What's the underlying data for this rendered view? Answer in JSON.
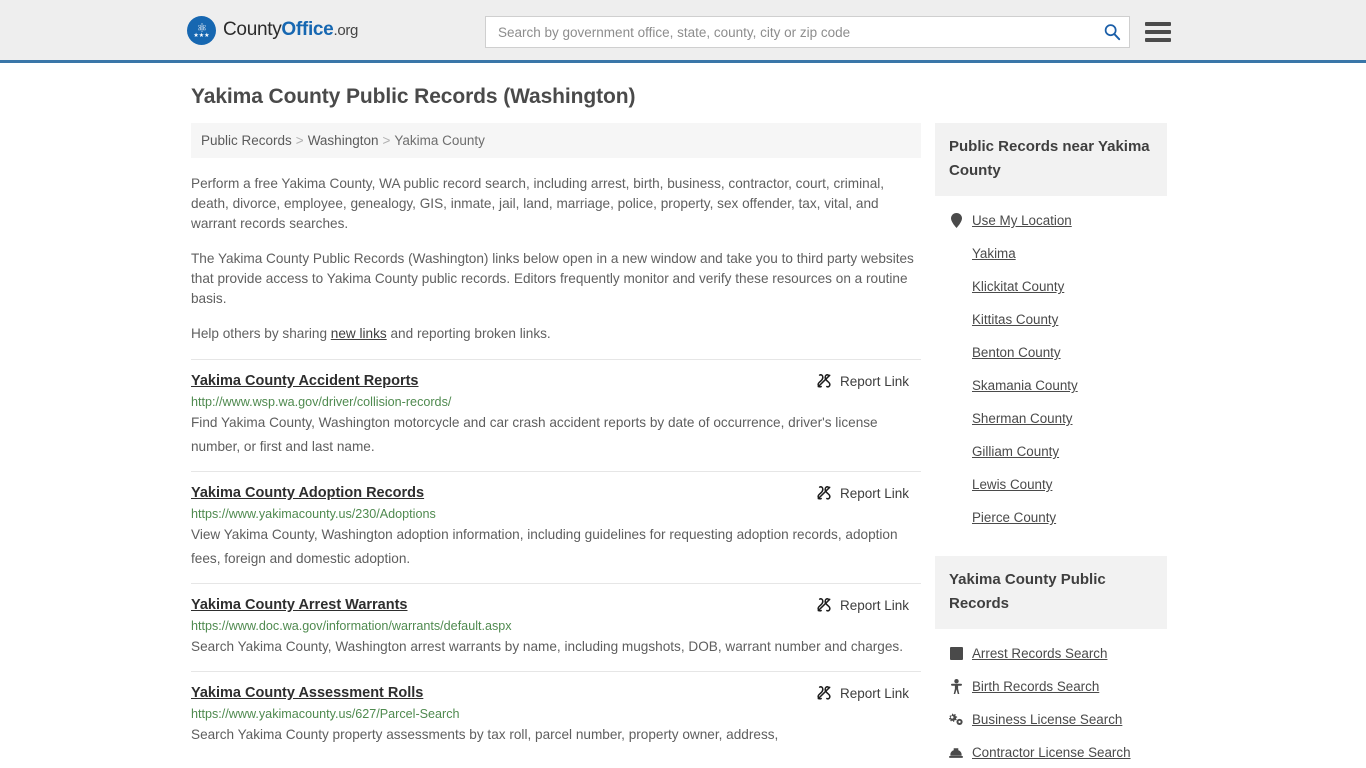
{
  "header": {
    "brand": {
      "part1": "County",
      "part2": "Office",
      "part3": ".org",
      "icon": "eagle-seal-icon"
    },
    "search": {
      "placeholder": "Search by government office, state, county, city or zip code",
      "value": "",
      "icon": "search-icon"
    },
    "menu_icon": "hamburger-menu-icon",
    "accent_color": "#3a76a8",
    "background_color": "#eeeeee"
  },
  "page": {
    "title": "Yakima County Public Records (Washington)"
  },
  "breadcrumb": {
    "items": [
      "Public Records",
      "Washington",
      "Yakima County"
    ],
    "separator": ">"
  },
  "intro": {
    "paragraph1": "Perform a free Yakima County, WA public record search, including arrest, birth, business, contractor, court, criminal, death, divorce, employee, genealogy, GIS, inmate, jail, land, marriage, police, property, sex offender, tax, vital, and warrant records searches.",
    "paragraph2": "The Yakima County Public Records (Washington) links below open in a new window and take you to third party websites that provide access to Yakima County public records. Editors frequently monitor and verify these resources on a routine basis.",
    "help_prefix": "Help others by sharing ",
    "help_link": "new links",
    "help_suffix": " and reporting broken links."
  },
  "report_link_label": "Report Link",
  "report_link_icon": "broken-link-icon",
  "records": [
    {
      "title": "Yakima County Accident Reports",
      "url": "http://www.wsp.wa.gov/driver/collision-records/",
      "description": "Find Yakima County, Washington motorcycle and car crash accident reports by date of occurrence, driver's license number, or first and last name."
    },
    {
      "title": "Yakima County Adoption Records",
      "url": "https://www.yakimacounty.us/230/Adoptions",
      "description": "View Yakima County, Washington adoption information, including guidelines for requesting adoption records, adoption fees, foreign and domestic adoption."
    },
    {
      "title": "Yakima County Arrest Warrants",
      "url": "https://www.doc.wa.gov/information/warrants/default.aspx",
      "description": "Search Yakima County, Washington arrest warrants by name, including mugshots, DOB, warrant number and charges."
    },
    {
      "title": "Yakima County Assessment Rolls",
      "url": "https://www.yakimacounty.us/627/Parcel-Search",
      "description": "Search Yakima County property assessments by tax roll, parcel number, property owner, address,"
    }
  ],
  "sidebar": {
    "nearby": {
      "heading": "Public Records near Yakima County",
      "items": [
        {
          "label": "Use My Location",
          "icon": "map-pin-icon"
        },
        {
          "label": "Yakima",
          "icon": ""
        },
        {
          "label": "Klickitat County",
          "icon": ""
        },
        {
          "label": "Kittitas County",
          "icon": ""
        },
        {
          "label": "Benton County",
          "icon": ""
        },
        {
          "label": "Skamania County",
          "icon": ""
        },
        {
          "label": "Sherman County",
          "icon": ""
        },
        {
          "label": "Gilliam County",
          "icon": ""
        },
        {
          "label": "Lewis County",
          "icon": ""
        },
        {
          "label": "Pierce County",
          "icon": ""
        }
      ]
    },
    "records": {
      "heading": "Yakima County Public Records",
      "items": [
        {
          "label": "Arrest Records Search",
          "icon": "fingerprint-card-icon"
        },
        {
          "label": "Birth Records Search",
          "icon": "baby-icon"
        },
        {
          "label": "Business License Search",
          "icon": "gears-icon"
        },
        {
          "label": "Contractor License Search",
          "icon": "hard-hat-icon"
        }
      ]
    }
  }
}
